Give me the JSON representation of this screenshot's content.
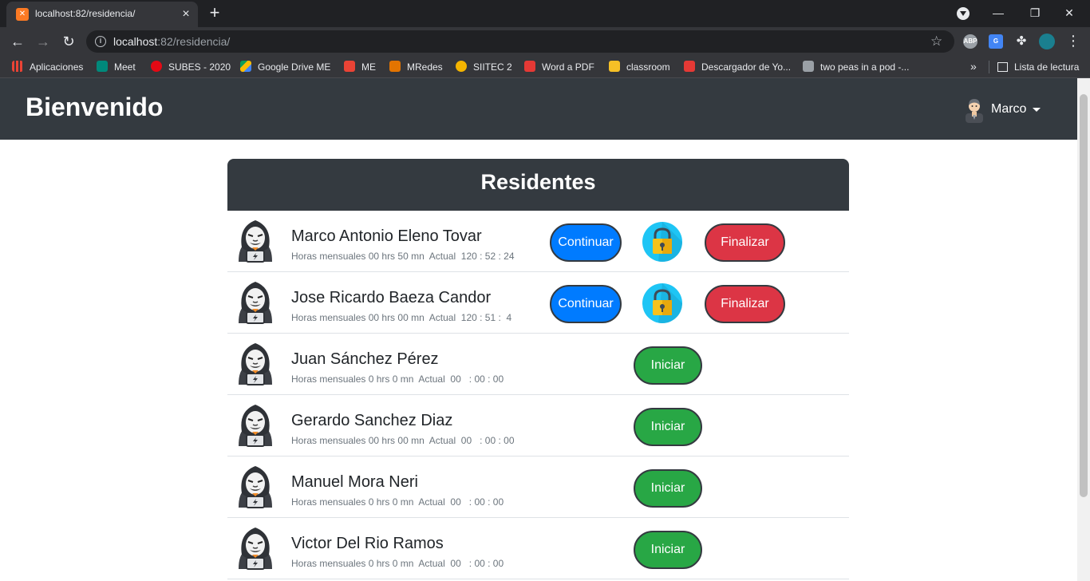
{
  "browser": {
    "tab_title": "localhost:82/residencia/",
    "url_host": "localhost",
    "url_rest": ":82/residencia/",
    "bookmarks": [
      {
        "label": "Aplicaciones",
        "color": "#ea4335"
      },
      {
        "label": "Meet",
        "color": "#00897b"
      },
      {
        "label": "SUBES - 2020",
        "color": "#e50914"
      },
      {
        "label": "Google Drive ME",
        "color": "#fbbc04"
      },
      {
        "label": "ME",
        "color": "#ea4335"
      },
      {
        "label": "MRedes",
        "color": "#e37400"
      },
      {
        "label": "SIITEC 2",
        "color": "#f4b400"
      },
      {
        "label": "Word a PDF",
        "color": "#e53935"
      },
      {
        "label": "classroom",
        "color": "#f6c026"
      },
      {
        "label": "Descargador de Yo...",
        "color": "#e53935"
      },
      {
        "label": "two peas in a pod -...",
        "color": "#9aa0a6"
      }
    ],
    "reading_list": "Lista de lectura"
  },
  "header": {
    "brand": "Bienvenido",
    "user_name": "Marco"
  },
  "card": {
    "title": "Residentes"
  },
  "residents": [
    {
      "name": "Marco Antonio Eleno Tovar",
      "hours": "Horas mensuales 00 hrs 50 mn  Actual  120 : 52 : 24",
      "state": "active"
    },
    {
      "name": "Jose Ricardo Baeza Candor",
      "hours": "Horas mensuales 00 hrs 00 mn  Actual  120 : 51 :  4",
      "state": "active"
    },
    {
      "name": "Juan Sánchez Pérez",
      "hours": "Horas mensuales 0 hrs 0 mn  Actual  00   : 00 : 00",
      "state": "idle"
    },
    {
      "name": "Gerardo Sanchez Diaz",
      "hours": "Horas mensuales 00 hrs 00 mn  Actual  00   : 00 : 00",
      "state": "idle"
    },
    {
      "name": "Manuel Mora Neri",
      "hours": "Horas mensuales 0 hrs 0 mn  Actual  00   : 00 : 00",
      "state": "idle"
    },
    {
      "name": "Victor Del Rio Ramos",
      "hours": "Horas mensuales 0 hrs 0 mn  Actual  00   : 00 : 00",
      "state": "idle"
    }
  ],
  "buttons": {
    "continue_label": "Continuar",
    "finish_label": "Finalizar",
    "start_label": "Iniciar"
  },
  "colors": {
    "navbar": "#343a40",
    "continue": "#007bff",
    "finish": "#dc3545",
    "start": "#28a745",
    "lock": "#1ec5f5"
  }
}
